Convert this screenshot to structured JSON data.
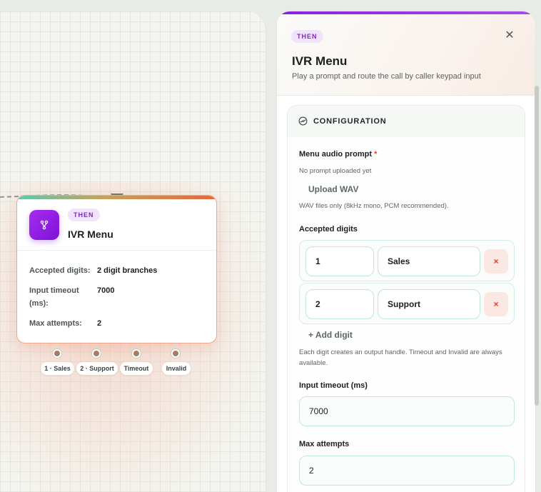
{
  "canvas": {
    "node": {
      "badge": "THEN",
      "title": "IVR Menu",
      "icon": "branch-icon",
      "rows": [
        {
          "key": "Accepted digits:",
          "value": "2 digit branches"
        },
        {
          "key": "Input timeout (ms):",
          "value": "7000"
        },
        {
          "key": "Max attempts:",
          "value": "2"
        }
      ],
      "handles": [
        "1 · Sales",
        "2 · Support",
        "Timeout",
        "Invalid"
      ]
    }
  },
  "panel": {
    "badge": "THEN",
    "close_icon": "close-icon",
    "title": "IVR Menu",
    "subtitle": "Play a prompt and route the call by caller keypad input",
    "section_title": "CONFIGURATION",
    "prompt": {
      "label": "Menu audio prompt",
      "required_mark": "*",
      "status": "No prompt uploaded yet",
      "upload_label": "Upload WAV",
      "hint": "WAV files only (8kHz mono, PCM recommended)."
    },
    "digits": {
      "label": "Accepted digits",
      "rows": [
        {
          "digit": "1",
          "name": "Sales"
        },
        {
          "digit": "2",
          "name": "Support"
        }
      ],
      "remove_label": "×",
      "add_label": "+ Add digit",
      "hint": "Each digit creates an output handle. Timeout and Invalid are always available."
    },
    "timeout": {
      "label": "Input timeout (ms)",
      "value": "7000"
    },
    "attempts": {
      "label": "Max attempts",
      "value": "2"
    }
  },
  "colors": {
    "accent": "#8c1fe0",
    "node_border": "#f0a98f",
    "input_border": "#bfe6dc",
    "danger": "#d8402b"
  }
}
